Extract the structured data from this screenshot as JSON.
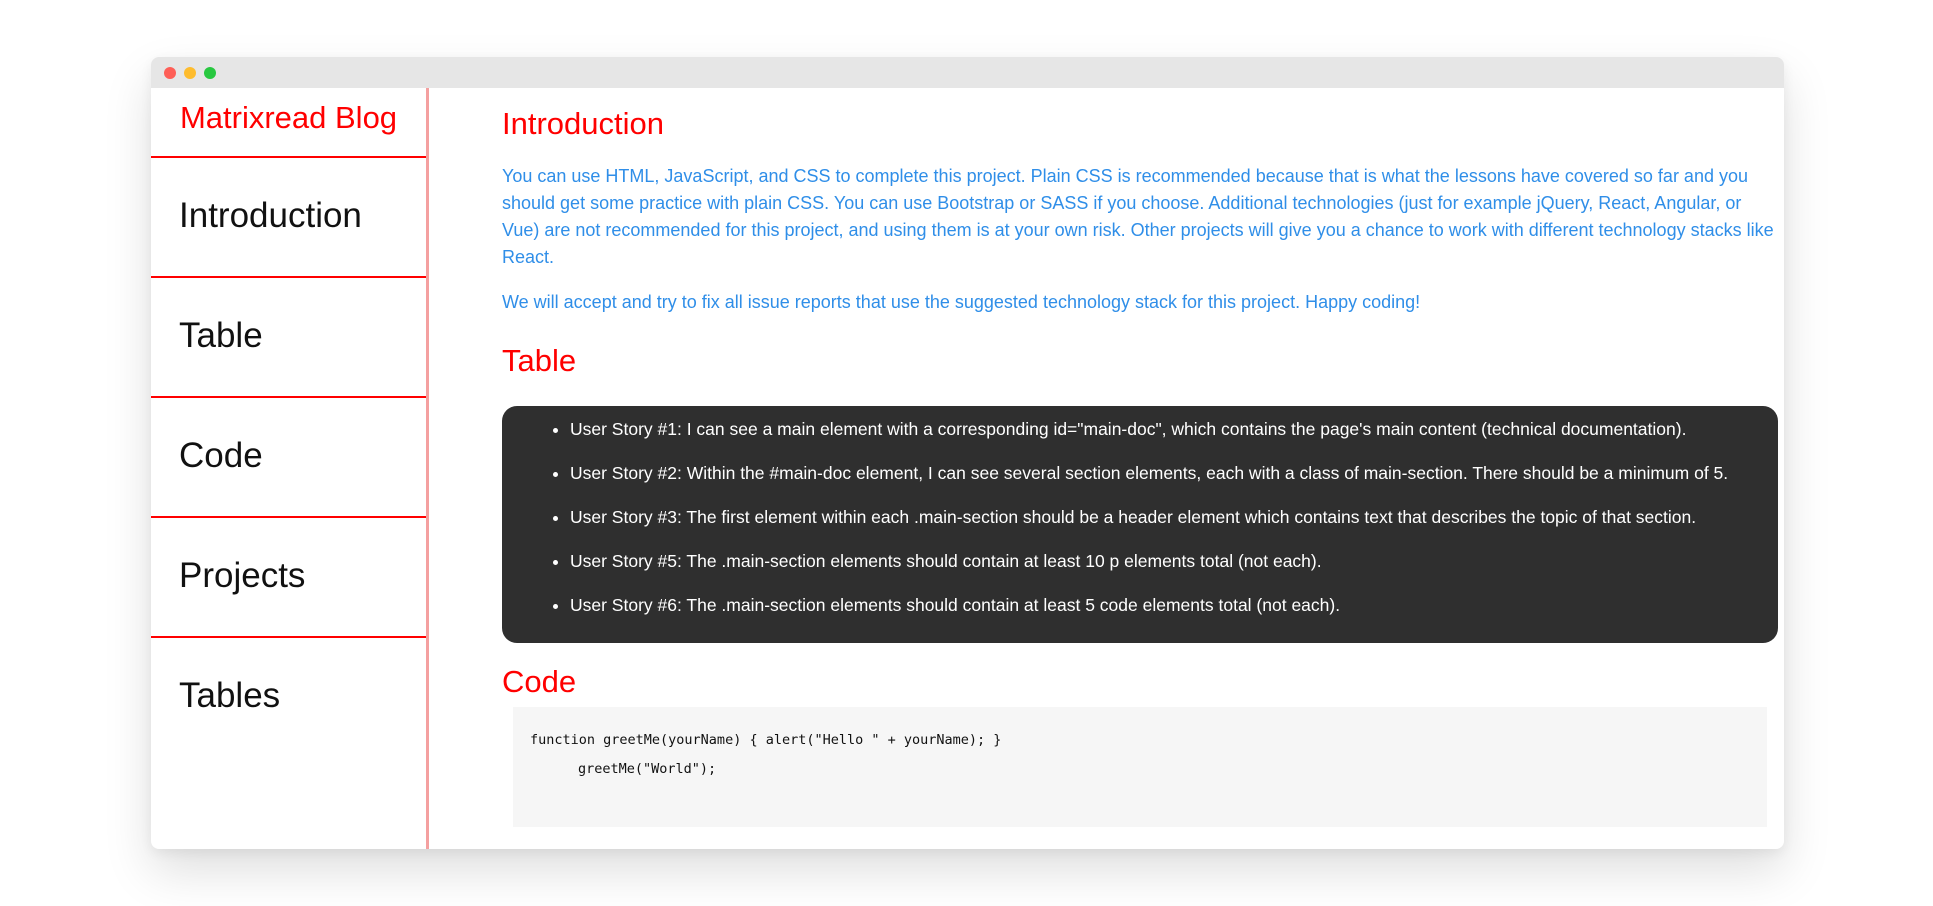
{
  "sidebar": {
    "brand": "Matrixread Blog",
    "items": [
      {
        "label": "Introduction"
      },
      {
        "label": "Table"
      },
      {
        "label": "Code"
      },
      {
        "label": "Projects"
      },
      {
        "label": "Tables"
      }
    ]
  },
  "main": {
    "introduction": {
      "title": "Introduction",
      "paragraphs": [
        "You can use HTML, JavaScript, and CSS to complete this project. Plain CSS is recommended because that is what the lessons have covered so far and you should get some practice with plain CSS. You can use Bootstrap or SASS if you choose. Additional technologies (just for example jQuery, React, Angular, or Vue) are not recommended for this project, and using them is at your own risk. Other projects will give you a chance to work with different technology stacks like React.",
        "We will accept and try to fix all issue reports that use the suggested technology stack for this project. Happy coding!"
      ]
    },
    "table": {
      "title": "Table",
      "stories": [
        "User Story #1: I can see a main element with a corresponding id=\"main-doc\", which contains the page's main content (technical documentation).",
        "User Story #2: Within the #main-doc element, I can see several section elements, each with a class of main-section. There should be a minimum of 5.",
        "User Story #3: The first element within each .main-section should be a header element which contains text that describes the topic of that section.",
        "User Story #5: The .main-section elements should contain at least 10 p elements total (not each).",
        "User Story #6: The .main-section elements should contain at least 5 code elements total (not each)."
      ]
    },
    "code": {
      "title": "Code",
      "lines": [
        "function greetMe(yourName) { alert(\"Hello \" + yourName); }",
        "greetMe(\"World\");"
      ]
    }
  },
  "colors": {
    "accent_red": "#ff0000",
    "link_blue": "#2f8ee8",
    "story_bg": "#2f2f2f",
    "code_bg": "#f6f6f6"
  }
}
